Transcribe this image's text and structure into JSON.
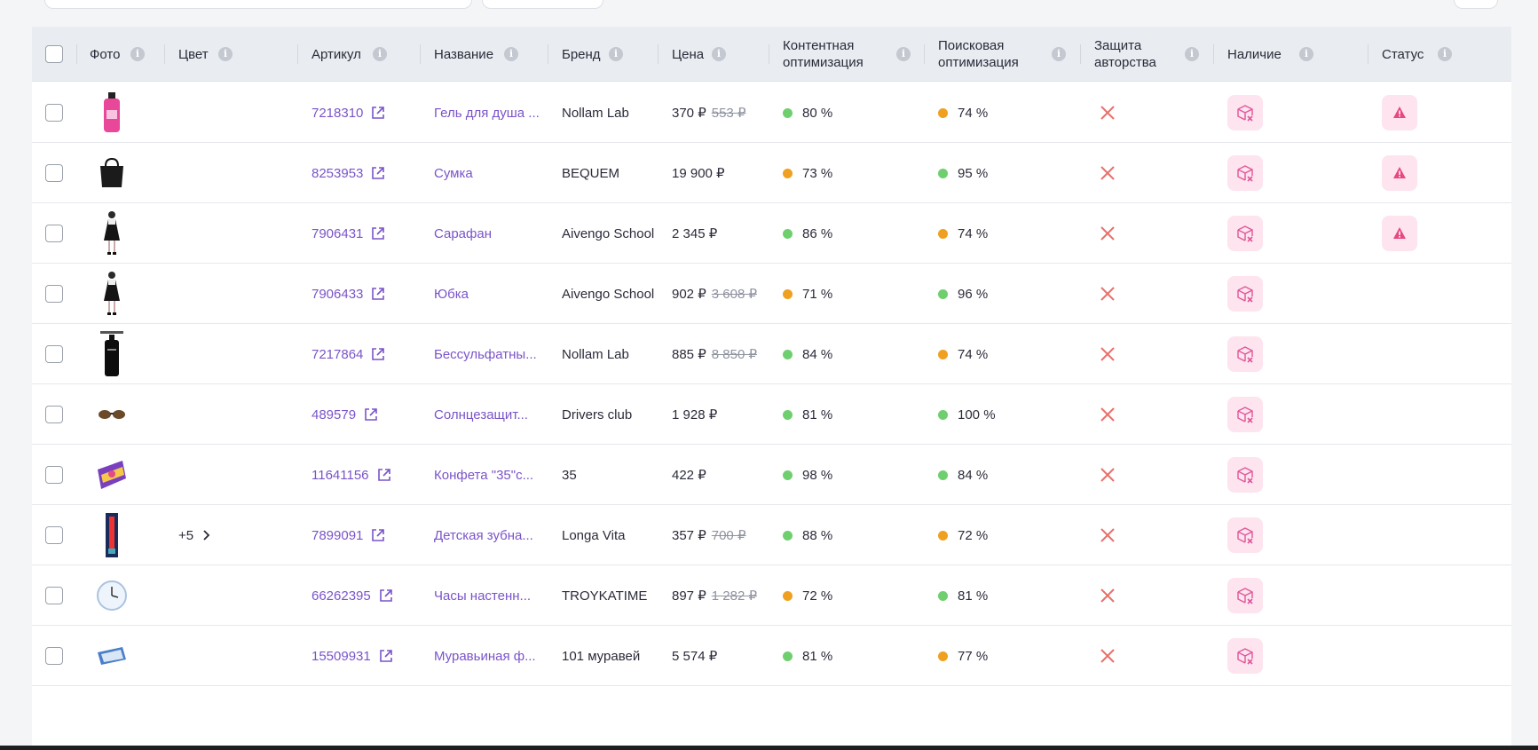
{
  "header": {
    "photo": "Фото",
    "color": "Цвет",
    "article": "Артикул",
    "name": "Название",
    "brand": "Бренд",
    "price": "Цена",
    "content_opt_1": "Контентная",
    "content_opt_2": "оптимизация",
    "search_opt_1": "Поисковая",
    "search_opt_2": "оптимизация",
    "protection_1": "Защита",
    "protection_2": "авторства",
    "availability": "Наличие",
    "status": "Статус"
  },
  "rows": [
    {
      "article": "7218310",
      "name": "Гель для душа ...",
      "brand": "Nollam Lab",
      "price": "370 ₽",
      "old_price": "553 ₽",
      "content": "80 %",
      "content_color": "#6fcf6f",
      "search": "74 %",
      "search_color": "#f0a020",
      "status_warning": true,
      "color_more": "",
      "thumb": "pink-bottle"
    },
    {
      "article": "8253953",
      "name": "Сумка",
      "brand": "BEQUEM",
      "price": "19 900 ₽",
      "old_price": "",
      "content": "73 %",
      "content_color": "#f0a020",
      "search": "95 %",
      "search_color": "#6fcf6f",
      "status_warning": true,
      "color_more": "",
      "thumb": "black-bag"
    },
    {
      "article": "7906431",
      "name": "Сарафан",
      "brand": "Aivengo School",
      "price": "2 345 ₽",
      "old_price": "",
      "content": "86 %",
      "content_color": "#6fcf6f",
      "search": "74 %",
      "search_color": "#f0a020",
      "status_warning": true,
      "color_more": "",
      "thumb": "dress"
    },
    {
      "article": "7906433",
      "name": "Юбка",
      "brand": "Aivengo School",
      "price": "902 ₽",
      "old_price": "3 608 ₽",
      "content": "71 %",
      "content_color": "#f0a020",
      "search": "96 %",
      "search_color": "#6fcf6f",
      "status_warning": false,
      "color_more": "",
      "thumb": "dress"
    },
    {
      "article": "7217864",
      "name": "Бессульфатны...",
      "brand": "Nollam Lab",
      "price": "885 ₽",
      "old_price": "8 850 ₽",
      "content": "84 %",
      "content_color": "#6fcf6f",
      "search": "74 %",
      "search_color": "#f0a020",
      "status_warning": false,
      "color_more": "",
      "thumb": "black-bottle"
    },
    {
      "article": "489579",
      "name": "Солнцезащит...",
      "brand": "Drivers club",
      "price": "1 928 ₽",
      "old_price": "",
      "content": "81 %",
      "content_color": "#6fcf6f",
      "search": "100 %",
      "search_color": "#6fcf6f",
      "status_warning": false,
      "color_more": "",
      "thumb": "glasses"
    },
    {
      "article": "11641156",
      "name": "Конфета \"35\"с...",
      "brand": "35",
      "price": "422 ₽",
      "old_price": "",
      "content": "98 %",
      "content_color": "#6fcf6f",
      "search": "84 %",
      "search_color": "#6fcf6f",
      "status_warning": false,
      "color_more": "",
      "thumb": "candy-box"
    },
    {
      "article": "7899091",
      "name": "Детская зубна...",
      "brand": "Longa Vita",
      "price": "357 ₽",
      "old_price": "700 ₽",
      "content": "88 %",
      "content_color": "#6fcf6f",
      "search": "72 %",
      "search_color": "#f0a020",
      "status_warning": false,
      "color_more": "+5",
      "thumb": "toothbrush"
    },
    {
      "article": "66262395",
      "name": "Часы настенн...",
      "brand": "TROYKATIME",
      "price": "897 ₽",
      "old_price": "1 282 ₽",
      "content": "72 %",
      "content_color": "#f0a020",
      "search": "81 %",
      "search_color": "#6fcf6f",
      "status_warning": false,
      "color_more": "",
      "thumb": "clock"
    },
    {
      "article": "15509931",
      "name": "Муравьиная ф...",
      "brand": "101 муравей",
      "price": "5 574 ₽",
      "old_price": "",
      "content": "81 %",
      "content_color": "#6fcf6f",
      "search": "77 %",
      "search_color": "#f0a020",
      "status_warning": false,
      "color_more": "",
      "thumb": "ant-farm"
    }
  ]
}
